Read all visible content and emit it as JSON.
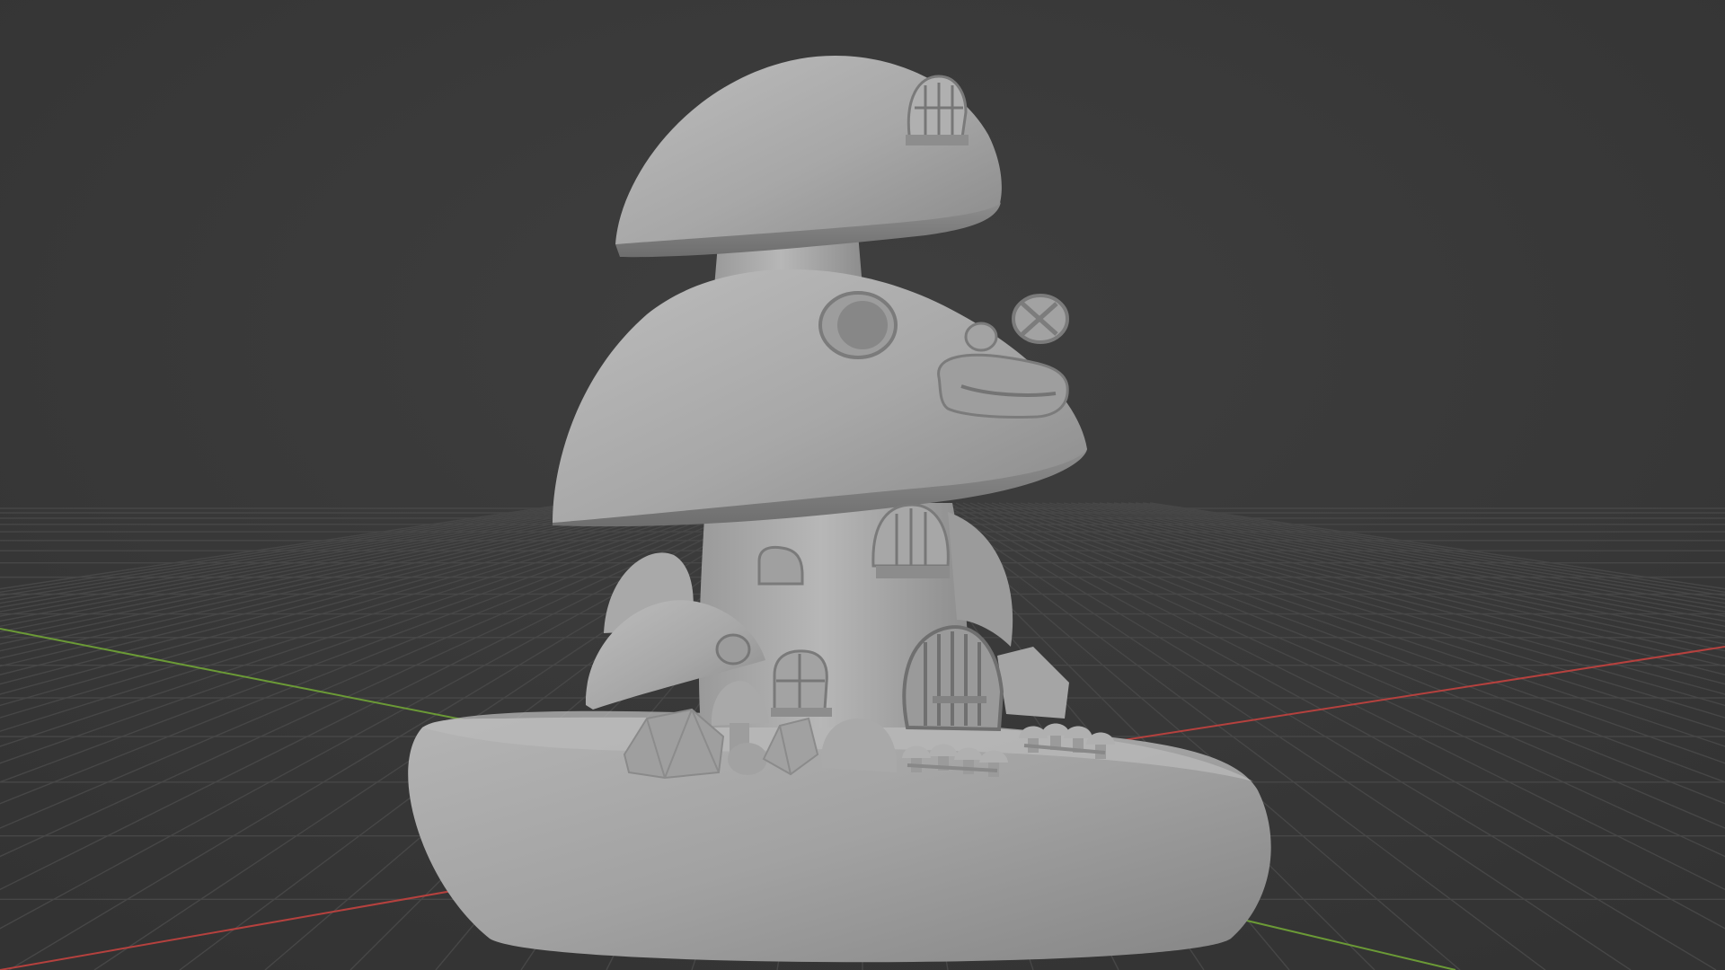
{
  "viewport": {
    "view_mode": "3d-viewport-solid-shading",
    "background_color": "#3b3b3b",
    "grid_line_color": "#474747",
    "x_axis_color": "#b5413e",
    "y_axis_color": "#6b9a36",
    "mesh_base_color": "#a4a4a4",
    "mesh_shadow_color": "#767676",
    "mesh_highlight_color": "#c2c2c2"
  },
  "scene": {
    "object_description_icon": "mushroom-house-model"
  }
}
